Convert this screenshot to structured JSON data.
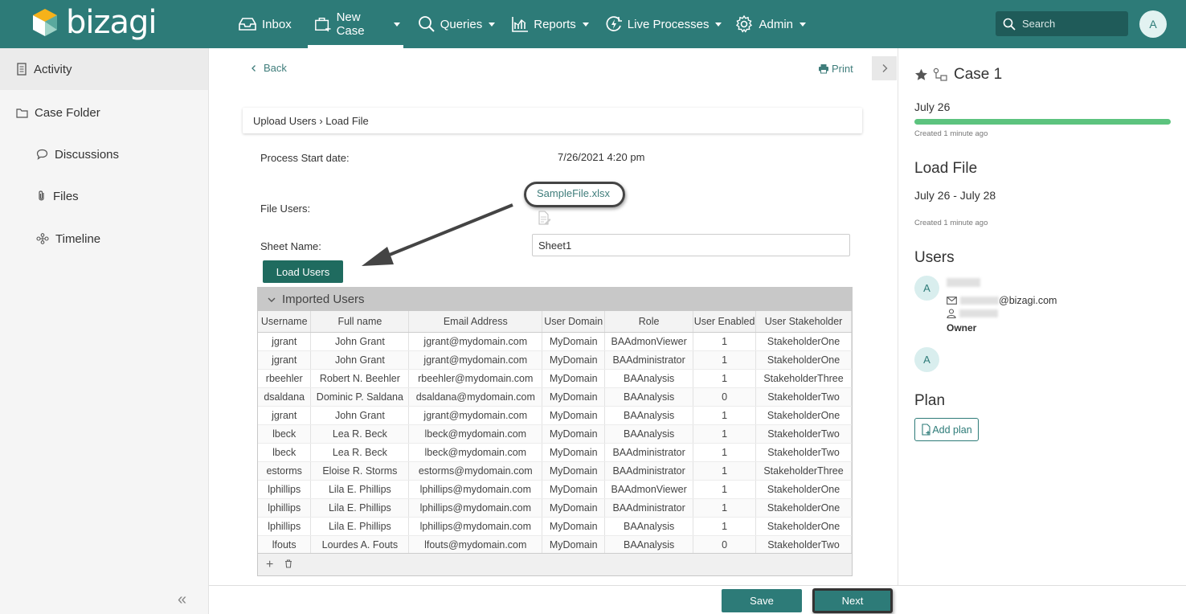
{
  "app": {
    "logo_text": "bizagi"
  },
  "nav": {
    "items": [
      {
        "label": "Inbox",
        "icon": "inbox-icon"
      },
      {
        "label": "New Case",
        "icon": "new-case-icon",
        "active": true
      },
      {
        "label": "Queries",
        "icon": "search-icon"
      },
      {
        "label": "Reports",
        "icon": "reports-icon"
      },
      {
        "label": "Live Processes",
        "icon": "live-processes-icon"
      },
      {
        "label": "Admin",
        "icon": "gear-icon"
      }
    ],
    "search_placeholder": "Search",
    "avatar": "A"
  },
  "sidebar": {
    "items": [
      {
        "label": "Activity",
        "icon": "activity-icon"
      },
      {
        "label": "Case Folder",
        "icon": "folder-icon"
      },
      {
        "label": "Discussions",
        "icon": "comment-icon"
      },
      {
        "label": "Files",
        "icon": "paperclip-icon"
      },
      {
        "label": "Timeline",
        "icon": "timeline-icon"
      }
    ],
    "collapse": "«"
  },
  "main": {
    "back": "Back",
    "print": "Print",
    "breadcrumb": "Upload Users › Load File",
    "process_start_label": "Process Start date:",
    "process_start_value": "7/26/2021 4:20 pm",
    "file_users_label": "File Users:",
    "file_name": "SampleFile.xlsx",
    "sheet_label": "Sheet Name:",
    "sheet_value": "Sheet1",
    "load_button": "Load Users"
  },
  "grid": {
    "title": "Imported Users",
    "columns": [
      "Username",
      "Full name",
      "Email Address",
      "User Domain",
      "Role",
      "User Enabled",
      "User Stakeholder"
    ],
    "rows": [
      [
        "jgrant",
        "John Grant",
        "jgrant@mydomain.com",
        "MyDomain",
        "BAAdmonViewer",
        "1",
        "StakeholderOne"
      ],
      [
        "jgrant",
        "John Grant",
        "jgrant@mydomain.com",
        "MyDomain",
        "BAAdministrator",
        "1",
        "StakeholderOne"
      ],
      [
        "rbeehler",
        "Robert N. Beehler",
        "rbeehler@mydomain.com",
        "MyDomain",
        "BAAnalysis",
        "1",
        "StakeholderThree"
      ],
      [
        "dsaldana",
        "Dominic P. Saldana",
        "dsaldana@mydomain.com",
        "MyDomain",
        "BAAnalysis",
        "0",
        "StakeholderTwo"
      ],
      [
        "jgrant",
        "John Grant",
        "jgrant@mydomain.com",
        "MyDomain",
        "BAAnalysis",
        "1",
        "StakeholderOne"
      ],
      [
        "lbeck",
        "Lea R. Beck",
        "lbeck@mydomain.com",
        "MyDomain",
        "BAAnalysis",
        "1",
        "StakeholderTwo"
      ],
      [
        "lbeck",
        "Lea R. Beck",
        "lbeck@mydomain.com",
        "MyDomain",
        "BAAdministrator",
        "1",
        "StakeholderTwo"
      ],
      [
        "estorms",
        "Eloise R. Storms",
        "estorms@mydomain.com",
        "MyDomain",
        "BAAdministrator",
        "1",
        "StakeholderThree"
      ],
      [
        "lphillips",
        "Lila E. Phillips",
        "lphillips@mydomain.com",
        "MyDomain",
        "BAAdmonViewer",
        "1",
        "StakeholderOne"
      ],
      [
        "lphillips",
        "Lila E. Phillips",
        "lphillips@mydomain.com",
        "MyDomain",
        "BAAdministrator",
        "1",
        "StakeholderOne"
      ],
      [
        "lphillips",
        "Lila E. Phillips",
        "lphillips@mydomain.com",
        "MyDomain",
        "BAAnalysis",
        "1",
        "StakeholderOne"
      ],
      [
        "lfouts",
        "Lourdes A. Fouts",
        "lfouts@mydomain.com",
        "MyDomain",
        "BAAnalysis",
        "0",
        "StakeholderTwo"
      ]
    ],
    "add": "+",
    "delete": "🗑"
  },
  "actions": {
    "save": "Save",
    "next": "Next"
  },
  "right": {
    "case_title": "Case 1",
    "case_date": "July 26",
    "case_created": "Created 1 minute ago",
    "task_title": "Load File",
    "task_dates": "July 26 - July 28",
    "task_created": "Created 1 minute ago",
    "progress": 1.0,
    "users_title": "Users",
    "user1_avatar": "A",
    "user1_email_suffix": "@bizagi.com",
    "user1_role": "Owner",
    "user2_avatar": "A",
    "plan_title": "Plan",
    "add_plan": "Add plan"
  }
}
